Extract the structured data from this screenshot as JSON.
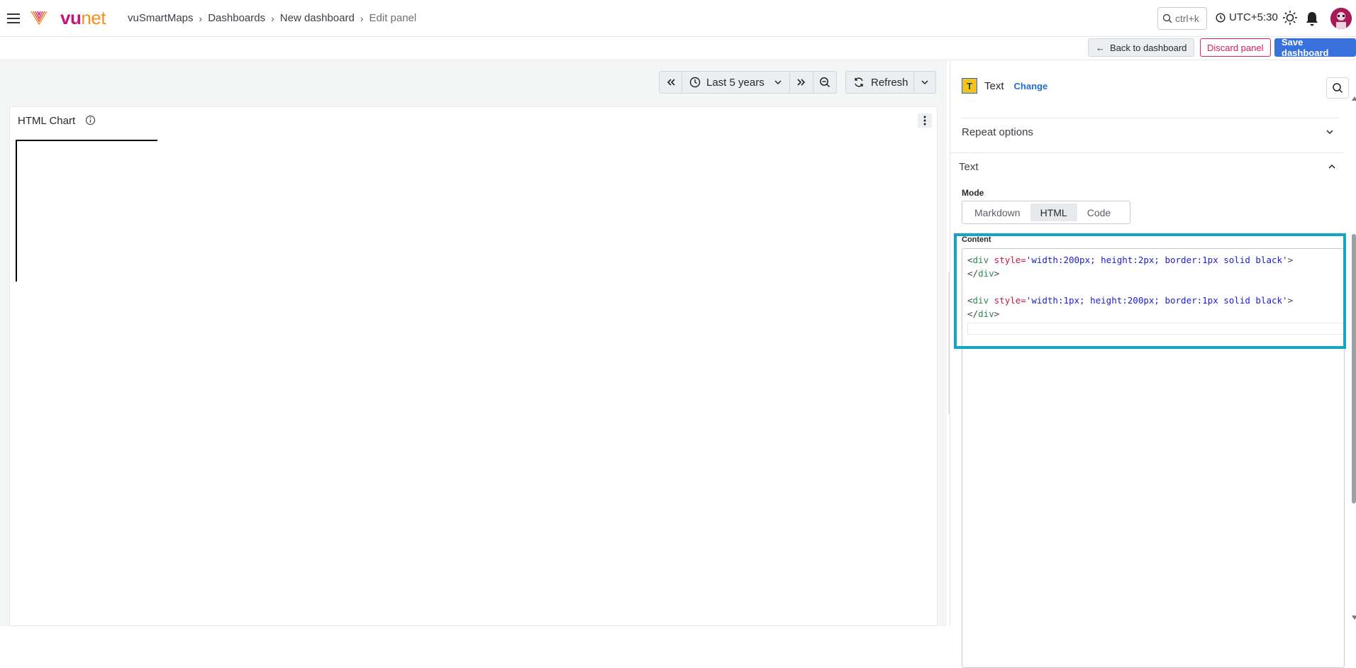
{
  "header": {
    "logo_vu": "vu",
    "logo_net": "net",
    "breadcrumb": [
      "vuSmartMaps",
      "Dashboards",
      "New dashboard",
      "Edit panel"
    ],
    "search_shortcut": "ctrl+k",
    "timezone": "UTC+5:30"
  },
  "actions": {
    "back": "Back to dashboard",
    "discard": "Discard panel",
    "save": "Save dashboard"
  },
  "timebar": {
    "range": "Last 5 years",
    "refresh": "Refresh"
  },
  "panel": {
    "title": "HTML Chart"
  },
  "options": {
    "visualization": "Text",
    "change": "Change",
    "repeat_options": "Repeat options",
    "text_section": "Text",
    "mode_label": "Mode",
    "modes": [
      "Markdown",
      "HTML",
      "Code"
    ],
    "active_mode": "HTML",
    "content_label": "Content",
    "content_lines": [
      "<div style='width:200px; height:2px; border:1px solid black'>",
      "</div>",
      "",
      "<div style='width:1px; height:200px; border:1px solid black'>",
      "</div>"
    ]
  },
  "colors": {
    "brand_pink": "#c6157a",
    "brand_orange": "#f39123",
    "primary": "#3871dc",
    "danger": "#d81b60",
    "highlight": "#12a5c6"
  }
}
